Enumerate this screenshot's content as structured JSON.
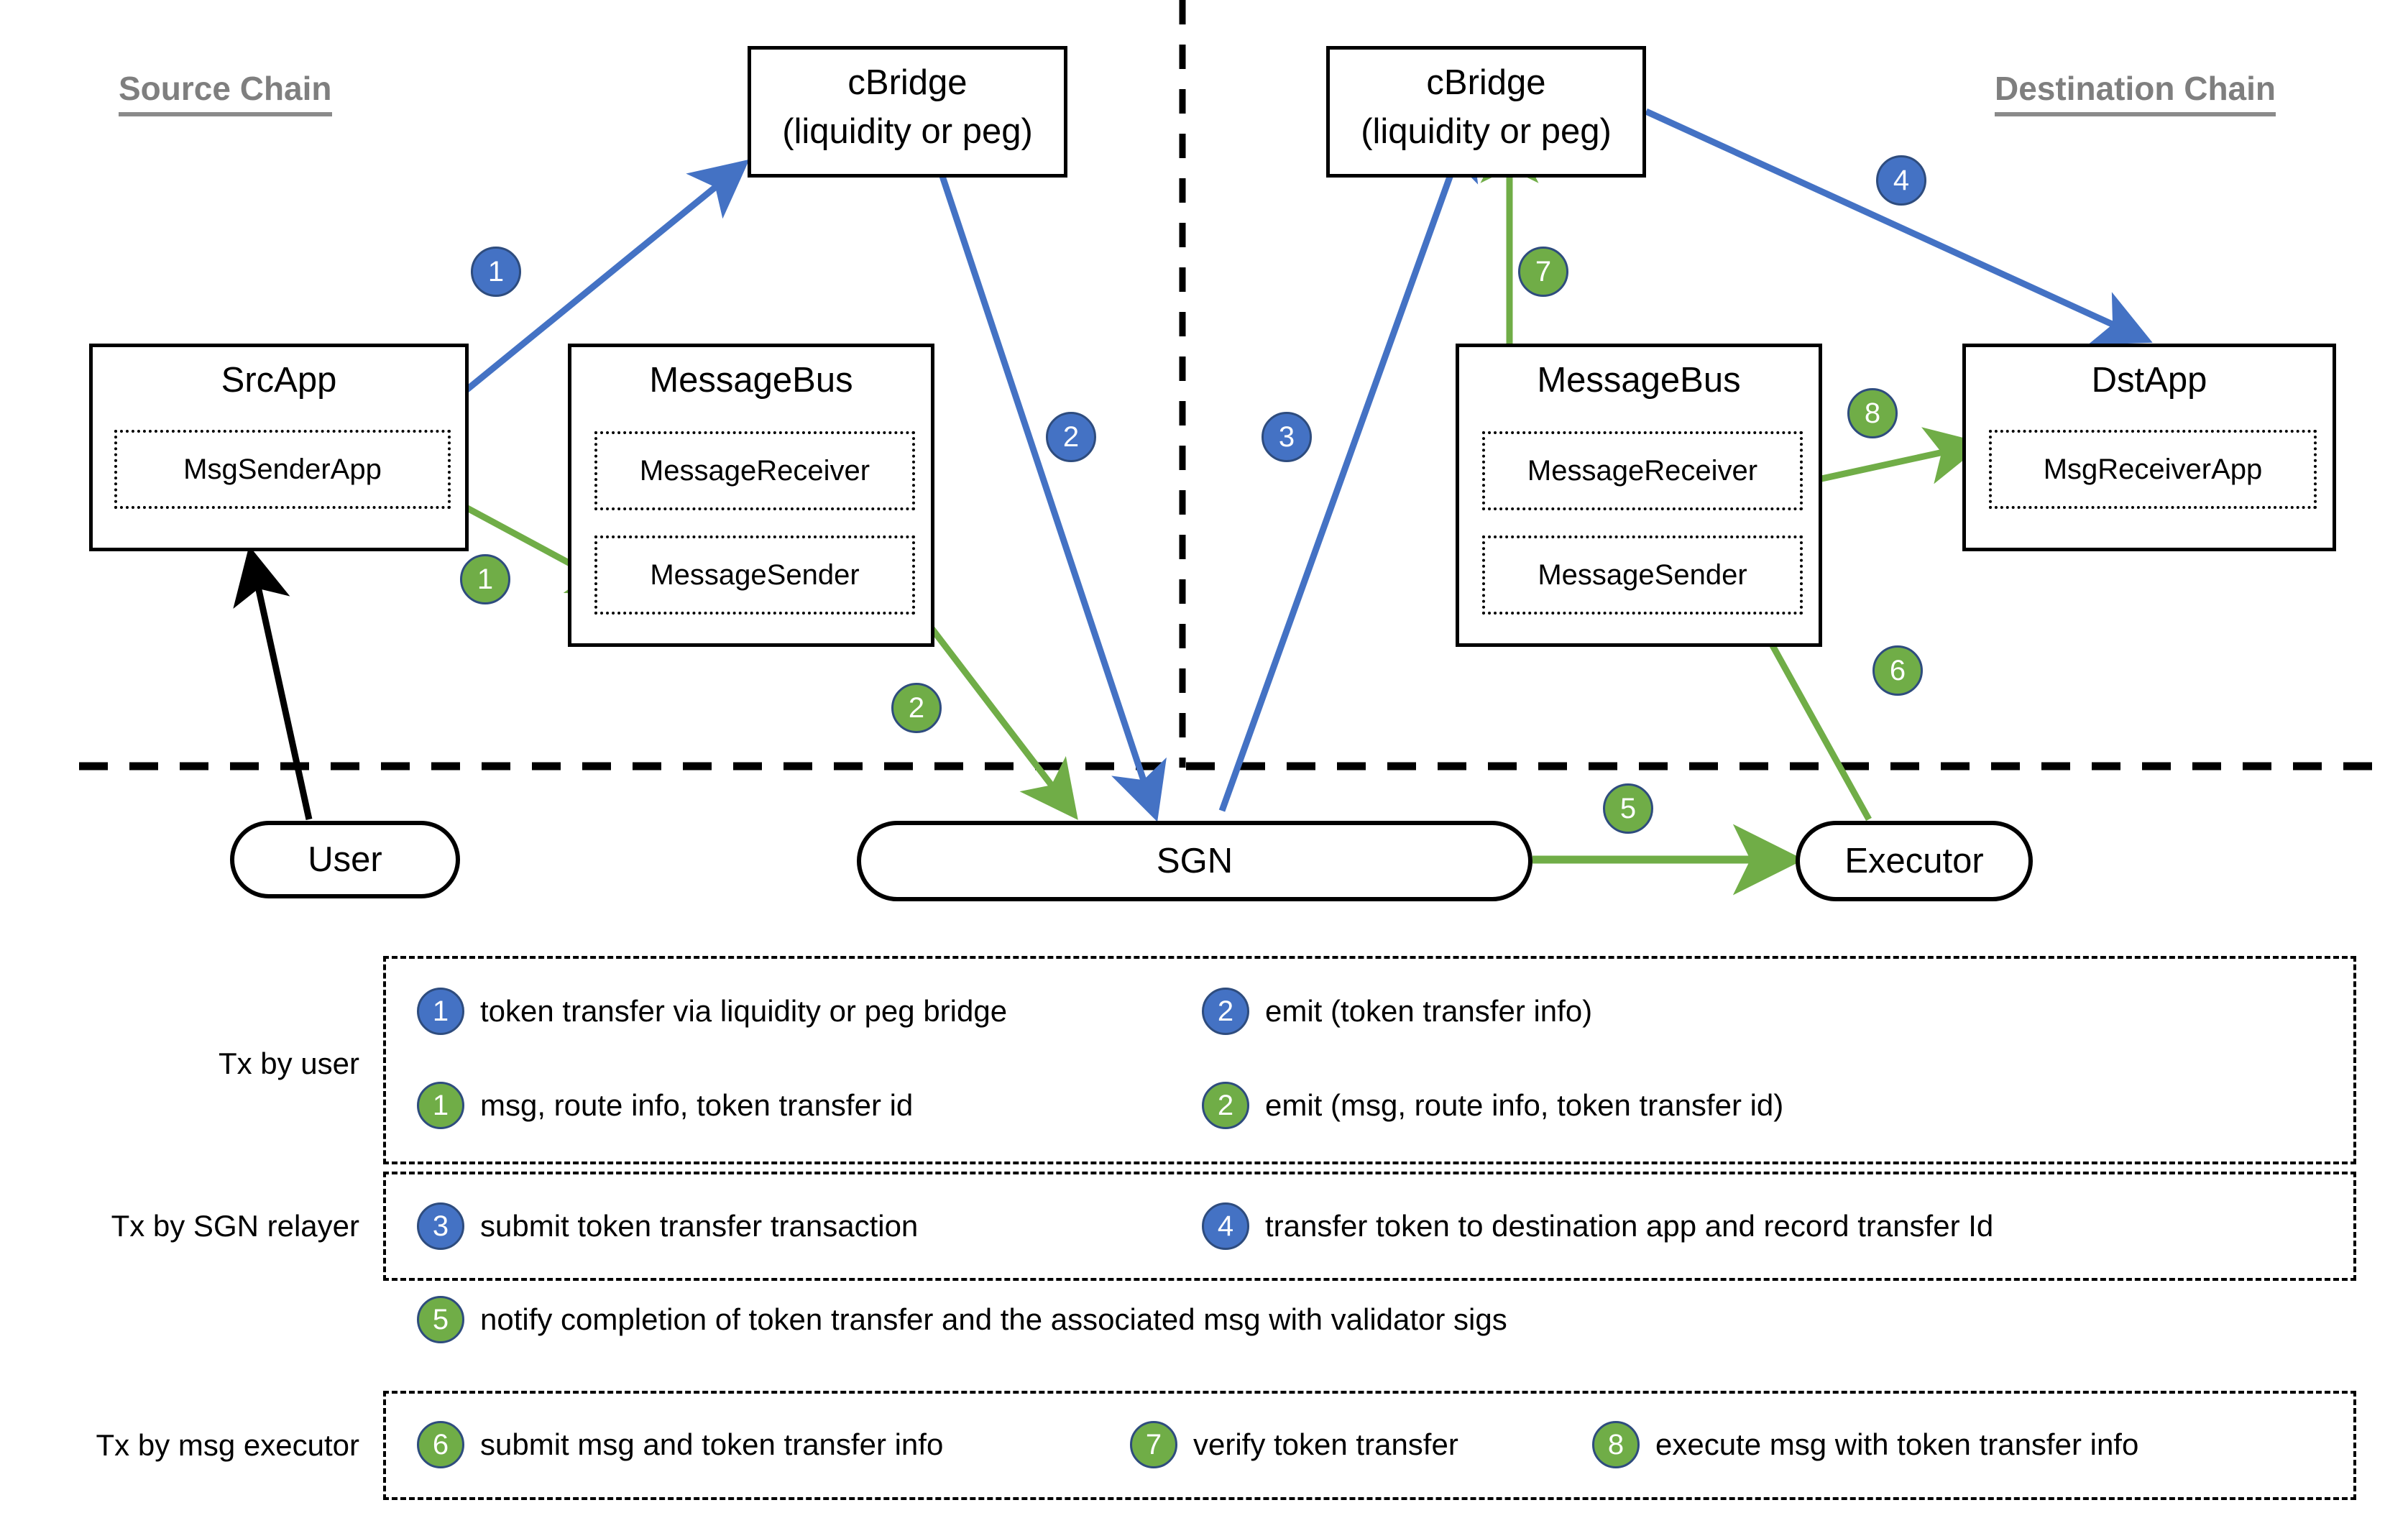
{
  "diagram": {
    "labels": {
      "source_chain": "Source Chain",
      "destination_chain": "Destination Chain"
    },
    "nodes": {
      "cbridge_src": {
        "title": "cBridge",
        "subtitle": "(liquidity or peg)"
      },
      "cbridge_dst": {
        "title": "cBridge",
        "subtitle": "(liquidity or peg)"
      },
      "srcapp": {
        "title": "SrcApp",
        "inner": "MsgSenderApp"
      },
      "messagebus_src": {
        "title": "MessageBus",
        "inner1": "MessageReceiver",
        "inner2": "MessageSender"
      },
      "messagebus_dst": {
        "title": "MessageBus",
        "inner1": "MessageReceiver",
        "inner2": "MessageSender"
      },
      "dstapp": {
        "title": "DstApp",
        "inner": "MsgReceiverApp"
      },
      "user": {
        "title": "User"
      },
      "sgn": {
        "title": "SGN"
      },
      "executor": {
        "title": "Executor"
      }
    },
    "flow_badges": [
      {
        "id": "b1-blue",
        "num": "1",
        "color": "blue"
      },
      {
        "id": "b2-blue",
        "num": "2",
        "color": "blue"
      },
      {
        "id": "b3-blue",
        "num": "3",
        "color": "blue"
      },
      {
        "id": "b4-blue",
        "num": "4",
        "color": "blue"
      },
      {
        "id": "b1-green",
        "num": "1",
        "color": "green"
      },
      {
        "id": "b2-green",
        "num": "2",
        "color": "green"
      },
      {
        "id": "b5-green",
        "num": "5",
        "color": "green"
      },
      {
        "id": "b6-green",
        "num": "6",
        "color": "green"
      },
      {
        "id": "b7-green",
        "num": "7",
        "color": "green"
      },
      {
        "id": "b8-green",
        "num": "8",
        "color": "green"
      }
    ]
  },
  "legend": {
    "row_labels": {
      "tx_by_user": "Tx by user",
      "tx_by_sgn_relayer": "Tx by SGN relayer",
      "tx_by_msg_executor": "Tx by msg executor"
    },
    "items": {
      "blue1": {
        "num": "1",
        "color": "blue",
        "text": "token transfer via liquidity or peg bridge"
      },
      "blue2": {
        "num": "2",
        "color": "blue",
        "text": "emit (token transfer info)"
      },
      "green1": {
        "num": "1",
        "color": "green",
        "text": "msg, route info, token transfer id"
      },
      "green2": {
        "num": "2",
        "color": "green",
        "text": "emit (msg, route info, token transfer id)"
      },
      "blue3": {
        "num": "3",
        "color": "blue",
        "text": "submit token transfer transaction"
      },
      "blue4": {
        "num": "4",
        "color": "blue",
        "text": "transfer token to destination app and record transfer Id"
      },
      "green5": {
        "num": "5",
        "color": "green",
        "text": "notify completion of token transfer and the associated msg with validator sigs"
      },
      "green6": {
        "num": "6",
        "color": "green",
        "text": "submit msg and token transfer info"
      },
      "green7": {
        "num": "7",
        "color": "green",
        "text": "verify token transfer"
      },
      "green8": {
        "num": "8",
        "color": "green",
        "text": "execute msg with token transfer info"
      }
    }
  },
  "colors": {
    "blue": "#4472C4",
    "green": "#70AD47",
    "badge_border": "#2E4C7E",
    "chain_label": "#7F7F7F",
    "outline": "#000000"
  }
}
